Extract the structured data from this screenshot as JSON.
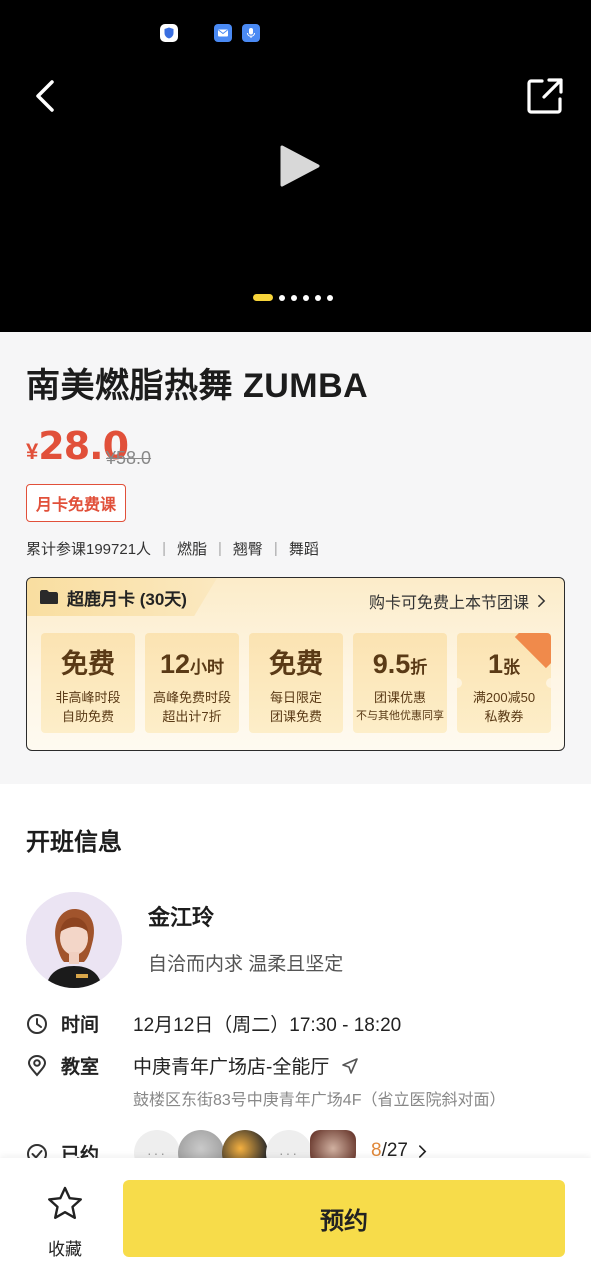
{
  "header": {
    "status_icons": [
      "shield-icon",
      "mail-icon",
      "mic-icon"
    ],
    "carousel": {
      "total": 6,
      "active_index": 0
    }
  },
  "course": {
    "title": "南美燃脂热舞 ZUMBA",
    "price_symbol": "¥",
    "price": "28.0",
    "original_price": "¥58.0",
    "badge": "月卡免费课",
    "stats": [
      "累计参课199721人",
      "燃脂",
      "翘臀",
      "舞蹈"
    ]
  },
  "membership": {
    "title": "超鹿月卡 (30天)",
    "link": "购卡可免费上本节团课",
    "benefits": [
      {
        "big": "免费",
        "small": "",
        "l1": "非高峰时段",
        "l2": "自助免费"
      },
      {
        "big": "12",
        "small": "小时",
        "l1": "高峰免费时段",
        "l2": "超出计7折"
      },
      {
        "big": "免费",
        "small": "",
        "l1": "每日限定",
        "l2": "团课免费"
      },
      {
        "big": "9.5",
        "small": "折",
        "l1": "团课优惠",
        "l2": "不与其他优惠同享"
      },
      {
        "big": "1",
        "small": "张",
        "l1": "满200减50",
        "l2": "私教券"
      }
    ]
  },
  "class_info": {
    "section_title": "开班信息",
    "teacher_name": "金江玲",
    "teacher_desc": "自洽而内求 温柔且坚定",
    "time_label": "时间",
    "time_value": "12月12日（周二）17:30 - 18:20",
    "room_label": "教室",
    "room_value": "中庚青年广场店-全能厅",
    "address": "鼓楼区东街83号中庚青年广场4F（省立医院斜对面）",
    "booked_label": "已约",
    "booked_current": "8",
    "booked_total": "/27",
    "face_placeholder": "···"
  },
  "bottom_bar": {
    "favorite_label": "收藏",
    "book_label": "预约"
  },
  "colors": {
    "accent_red": "#e1503a",
    "button_yellow": "#f7dc4a",
    "card_gold": "#fbe3b2"
  }
}
